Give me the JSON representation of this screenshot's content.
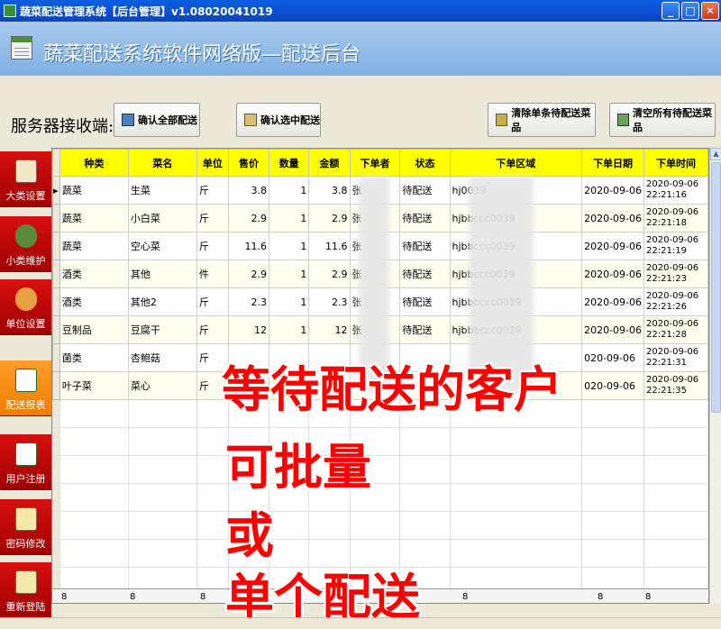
{
  "window": {
    "title": "蔬菜配送管理系统【后台管理】v1.08020041019"
  },
  "banner": {
    "title": "蔬菜配送系统软件网络版—配送后台"
  },
  "toolbar": {
    "server_label": "服务器接收端:",
    "confirm_all": "确认全部配送",
    "confirm_selected": "确认选中配送",
    "clear_single": "清除单条待配送菜品",
    "clear_all": "清空所有待配送菜品"
  },
  "sidebar": {
    "items": [
      {
        "label": "大类设置"
      },
      {
        "label": "小类维护"
      },
      {
        "label": "单位设置"
      },
      {
        "label": "配送报表"
      },
      {
        "label": "用户注册"
      },
      {
        "label": "密码修改"
      },
      {
        "label": "重新登陆"
      }
    ]
  },
  "table": {
    "columns": [
      "种类",
      "菜名",
      "单位",
      "售价",
      "数量",
      "金额",
      "下单者",
      "状态",
      "下单区域",
      "下单日期",
      "下单时间"
    ],
    "rows": [
      {
        "cat": "蔬菜",
        "name": "生菜",
        "unit": "斤",
        "price": "3.8",
        "qty": "1",
        "amount": "3.8",
        "user": "张",
        "status": "待配送",
        "area": "hj0039",
        "date": "2020-09-06",
        "time": "2020-09-06 22:21:16"
      },
      {
        "cat": "蔬菜",
        "name": "小白菜",
        "unit": "斤",
        "price": "2.9",
        "qty": "1",
        "amount": "2.9",
        "user": "张",
        "status": "待配送",
        "area": "hjbbccc0039",
        "date": "2020-09-06",
        "time": "2020-09-06 22:21:18"
      },
      {
        "cat": "蔬菜",
        "name": "空心菜",
        "unit": "斤",
        "price": "11.6",
        "qty": "1",
        "amount": "11.6",
        "user": "张",
        "status": "待配送",
        "area": "hjbbccc0039",
        "date": "2020-09-06",
        "time": "2020-09-06 22:21:19"
      },
      {
        "cat": "酒类",
        "name": "其他",
        "unit": "件",
        "price": "2.9",
        "qty": "1",
        "amount": "2.9",
        "user": "张",
        "status": "待配送",
        "area": "hjbbccc0039",
        "date": "2020-09-06",
        "time": "2020-09-06 22:21:23"
      },
      {
        "cat": "酒类",
        "name": "其他2",
        "unit": "斤",
        "price": "2.3",
        "qty": "1",
        "amount": "2.3",
        "user": "张",
        "status": "待配送",
        "area": "hjbbbccc0039",
        "date": "2020-09-06",
        "time": "2020-09-06 22:21:26"
      },
      {
        "cat": "豆制品",
        "name": "豆腐干",
        "unit": "斤",
        "price": "12",
        "qty": "1",
        "amount": "12",
        "user": "张",
        "status": "待配送",
        "area": "hjbbbccc0039",
        "date": "2020-09-06",
        "time": "2020-09-06 22:21:28"
      },
      {
        "cat": "菌类",
        "name": "杏鲍菇",
        "unit": "斤",
        "price": "",
        "qty": "",
        "amount": "",
        "user": "",
        "status": "",
        "area": "",
        "date": "020-09-06",
        "time": "2020-09-06 22:21:31"
      },
      {
        "cat": "叶子菜",
        "name": "菜心",
        "unit": "斤",
        "price": "",
        "qty": "",
        "amount": "",
        "user": "",
        "status": "",
        "area": "",
        "date": "020-09-06",
        "time": "2020-09-06 22:21:35"
      }
    ],
    "footer": [
      "8",
      "8",
      "8",
      "8",
      "8",
      "8"
    ]
  },
  "overlay": {
    "line1": "等待配送的客户",
    "line2": "可批量",
    "line3": "或",
    "line4": "单个配送"
  },
  "colors": {
    "header_yellow": "#ffff00",
    "sidebar_red": "#c00000",
    "sidebar_active": "#f08000",
    "overlay_red": "#ff0000"
  }
}
